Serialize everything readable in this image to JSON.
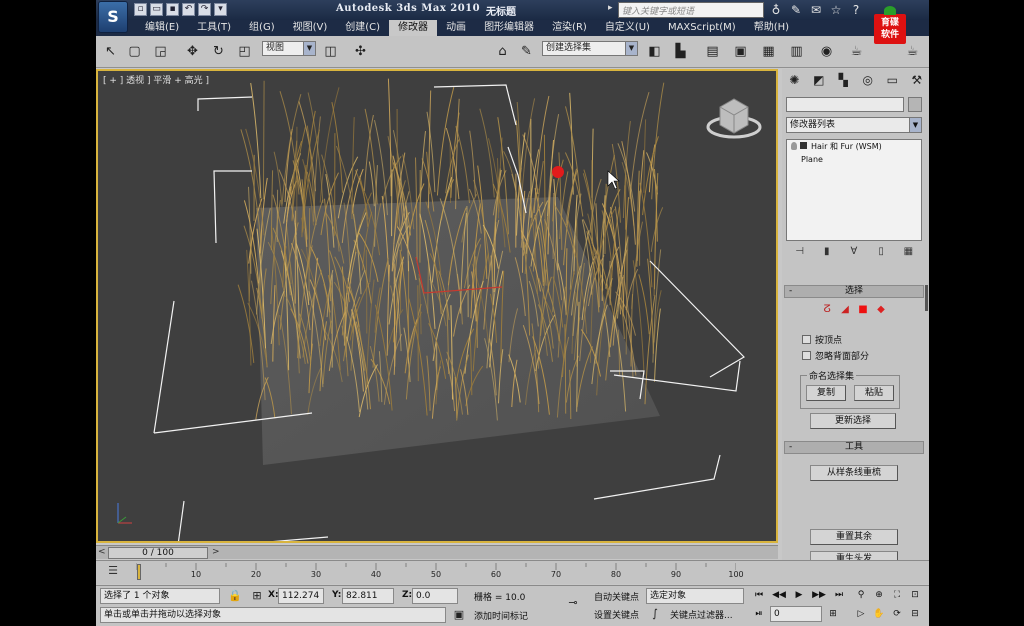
{
  "window": {
    "title": "Autodesk 3ds Max  2010",
    "document": "无标题"
  },
  "search": {
    "placeholder": "键入关键字或短语"
  },
  "menu": [
    "编辑(E)",
    "工具(T)",
    "组(G)",
    "视图(V)",
    "创建(C)",
    "修改器",
    "动画",
    "图形编辑器",
    "渲染(R)",
    "自定义(U)",
    "MAXScript(M)",
    "帮助(H)"
  ],
  "menu_active_index": 5,
  "brand": {
    "line1": "育碟",
    "line2": "软件"
  },
  "toolbar": {
    "ref_coord": "视图",
    "named_sel": "创建选择集"
  },
  "viewport": {
    "label": "[ + ] 透视 ] 平滑 + 高光 ]"
  },
  "command_panel": {
    "modifier_list": "修改器列表",
    "stack": [
      {
        "label": "Hair 和 Fur (WSM)",
        "type": "mod"
      },
      {
        "label": "Plane",
        "type": "base"
      }
    ],
    "selection": {
      "title": "选择",
      "by_vertex": "按顶点",
      "ignore_backfacing": "忽略背面部分",
      "named_sets": "命名选择集",
      "copy": "复制",
      "paste": "粘贴",
      "update": "更新选择"
    },
    "tools": {
      "title": "工具",
      "regrow": "从样条线重梳",
      "reset_rest": "重置其余",
      "regrow_hair": "重生头发"
    }
  },
  "timeline": {
    "frame": "0 / 100",
    "ticks": [
      10,
      20,
      30,
      40,
      50,
      60,
      70,
      80,
      90,
      100
    ]
  },
  "status": {
    "selected": "选择了 1 个对象",
    "prompt": "单击或单击并拖动以选择对象",
    "x": "112.274",
    "y": "82.811",
    "z": "0.0",
    "grid": "栅格 = 10.0",
    "add_time_tag": "添加时间标记",
    "auto_key": "自动关键点",
    "set_key": "设置关键点",
    "key_mode": "选定对象",
    "key_filters": "关键点过滤器...",
    "current_frame": "0"
  }
}
